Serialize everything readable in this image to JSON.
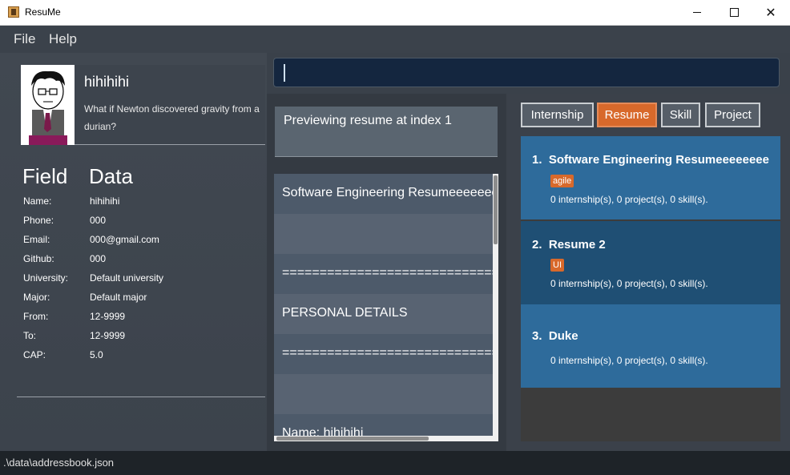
{
  "window": {
    "title": "ResuMe",
    "controls": {
      "minimize": "minimize-icon",
      "maximize": "maximize-icon",
      "close": "close-icon"
    }
  },
  "menu": {
    "file": "File",
    "help": "Help"
  },
  "profile": {
    "name": "hihihihi",
    "bio": "What if Newton discovered gravity from a durian?",
    "field_header": "Field",
    "data_header": "Data",
    "fields": [
      {
        "label": "Name:",
        "value": "hihihihi"
      },
      {
        "label": "Phone:",
        "value": "000"
      },
      {
        "label": "Email:",
        "value": "000@gmail.com"
      },
      {
        "label": "Github:",
        "value": "000"
      },
      {
        "label": "University:",
        "value": "Default university"
      },
      {
        "label": "Major:",
        "value": "Default major"
      },
      {
        "label": "From:",
        "value": "12-9999"
      },
      {
        "label": "To:",
        "value": "12-9999"
      },
      {
        "label": "CAP:",
        "value": "5.0"
      }
    ]
  },
  "command": {
    "value": ""
  },
  "preview": {
    "message": "Previewing resume at index 1",
    "lines": [
      "Software Engineering Resumeeeeeeee",
      "",
      "====================================",
      "PERSONAL DETAILS",
      "====================================",
      "",
      "Name: hihihihi"
    ]
  },
  "tabs": [
    "Internship",
    "Resume",
    "Skill",
    "Project"
  ],
  "active_tab": "Resume",
  "resumes": [
    {
      "index": "1.",
      "title": "Software Engineering Resumeeeeeeee",
      "tag": "agile",
      "summary": "0 internship(s), 0 project(s), 0 skill(s)."
    },
    {
      "index": "2.",
      "title": "Resume 2",
      "tag": "UI",
      "summary": "0 internship(s), 0 project(s), 0 skill(s)."
    },
    {
      "index": "3.",
      "title": "Duke",
      "tag": "",
      "summary": "0 internship(s), 0 project(s), 0 skill(s)."
    }
  ],
  "status": {
    "path": ".\\data\\addressbook.json"
  },
  "colors": {
    "accent": "#d8692b",
    "card": "#2e6b9b",
    "card_selected": "#1f4f74",
    "command_bg": "#14263f"
  }
}
